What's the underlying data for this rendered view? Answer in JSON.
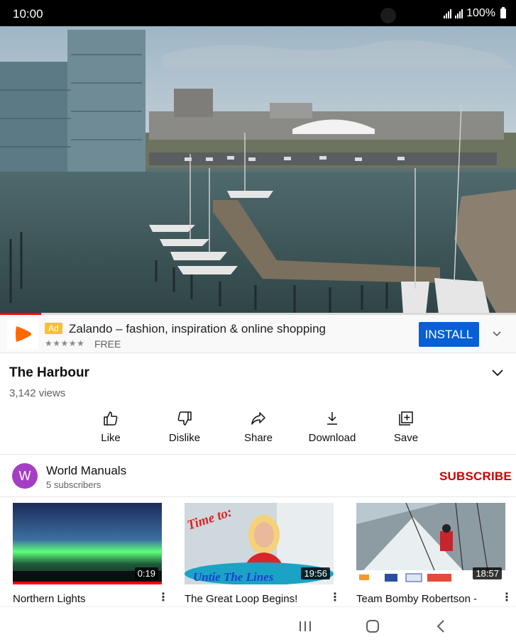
{
  "status_bar": {
    "time": "10:00",
    "battery": "100%"
  },
  "player": {
    "progress_fraction": 0.08
  },
  "ad": {
    "badge": "Ad",
    "title": "Zalando – fashion, inspiration & online shopping",
    "stars": "★★★★★",
    "price": "FREE",
    "install_label": "INSTALL"
  },
  "video": {
    "title": "The Harbour",
    "views": "3,142 views"
  },
  "actions": [
    {
      "label": "Like",
      "icon": "thumbs-up-icon"
    },
    {
      "label": "Dislike",
      "icon": "thumbs-down-icon"
    },
    {
      "label": "Share",
      "icon": "share-icon"
    },
    {
      "label": "Download",
      "icon": "download-icon"
    },
    {
      "label": "Save",
      "icon": "playlist-add-icon"
    }
  ],
  "channel": {
    "avatar_letter": "W",
    "avatar_color": "#a43fc4",
    "name": "World Manuals",
    "subscribers": "5 subscribers",
    "subscribe_label": "SUBSCRIBE"
  },
  "related": [
    {
      "title": "Northern Lights",
      "duration": "0:19"
    },
    {
      "title": "The Great Loop Begins!",
      "duration": "19:56",
      "thumb_text_top": "Time to:",
      "thumb_text_bottom": "Untie The Lines"
    },
    {
      "title": "Team Bomby Robertson -",
      "duration": "18:57"
    }
  ],
  "colors": {
    "accent_blue": "#065fd4",
    "subscribe_red": "#cc0000",
    "progress_red": "#ff0000",
    "ad_orange": "#ff6900"
  }
}
